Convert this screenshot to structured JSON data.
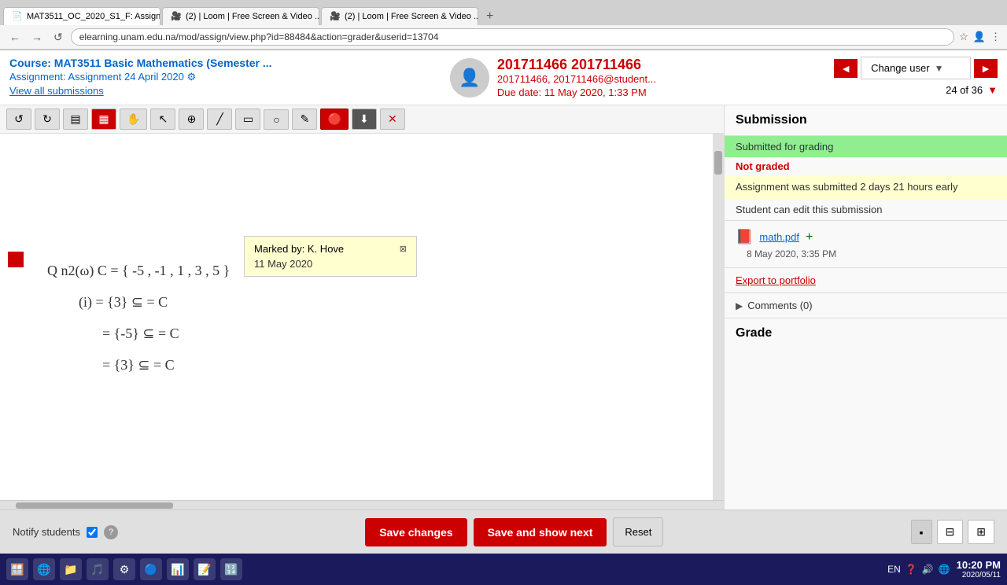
{
  "browser": {
    "tabs": [
      {
        "label": "MAT3511_OC_2020_S1_F: Assign...",
        "active": true,
        "favicon": "📄"
      },
      {
        "label": "(2) | Loom | Free Screen & Video ...",
        "active": false,
        "favicon": "🎥"
      },
      {
        "label": "(2) | Loom | Free Screen & Video ...",
        "active": false,
        "favicon": "🎥"
      }
    ],
    "url": "elearning.unam.edu.na/mod/assign/view.php?id=88484&action=grader&userid=13704"
  },
  "header": {
    "course_title": "Course: MAT3511 Basic Mathematics (Semester ...",
    "assignment_title": "Assignment: Assignment 24 April 2020 ⚙",
    "view_all": "View all submissions",
    "student_id1": "201711466 201711466",
    "student_id2": "201711466, 201711466@student...",
    "due_date": "Due date: 11 May 2020, 1:33 PM",
    "change_user": "Change user",
    "counter": "24 of 36"
  },
  "toolbar": {
    "tools": [
      "↺",
      "↻",
      "▤",
      "▦",
      "✋",
      "↖",
      "⊕",
      "╱",
      "▭",
      "○",
      "✎",
      "🩸",
      "⬇",
      "✕"
    ]
  },
  "annotation": {
    "marked_by": "Marked by: K. Hove",
    "date": "11 May 2020"
  },
  "submission": {
    "title": "Submission",
    "status_submitted": "Submitted for grading",
    "status_not_graded": "Not graded",
    "status_early": "Assignment was submitted 2 days 21 hours early",
    "status_edit": "Student can edit this submission",
    "file_name": "math.pdf",
    "file_date": "8 May 2020, 3:35 PM",
    "export": "Export to portfolio",
    "comments": "Comments (0)",
    "grade_title": "Grade"
  },
  "bottom_bar": {
    "notify_label": "Notify students",
    "save_changes": "Save changes",
    "save_show_next": "Save and show next",
    "reset": "Reset"
  },
  "taskbar": {
    "lang": "EN",
    "time": "10:20 PM",
    "date": "2020/05/11"
  }
}
